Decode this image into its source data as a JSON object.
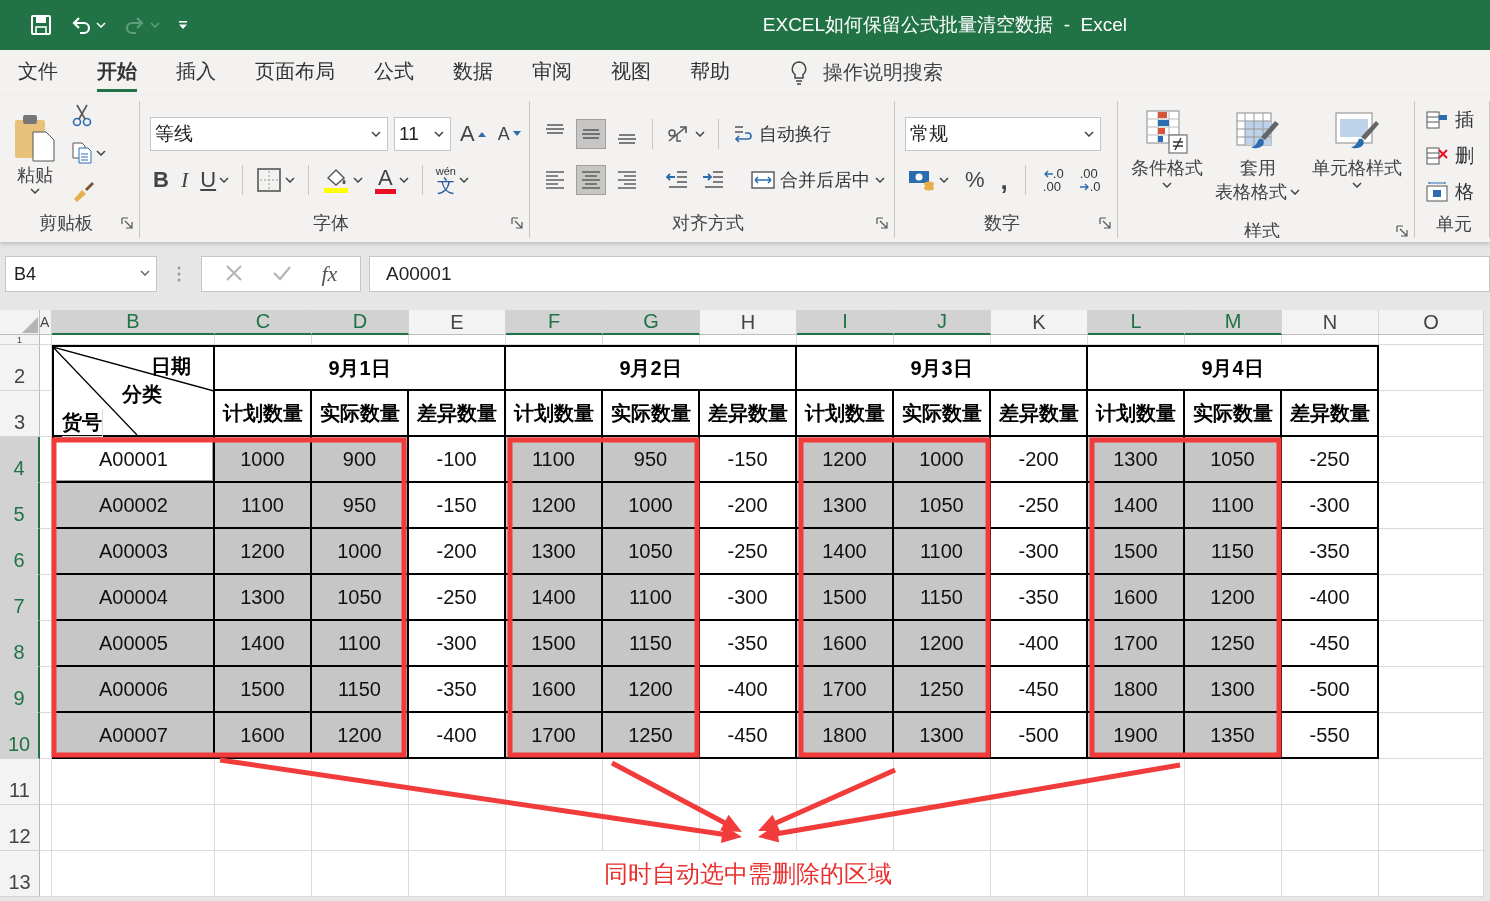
{
  "window": {
    "title": "EXCEL如何保留公式批量清空数据  -  Excel"
  },
  "quick_access": [
    {
      "kind": "save",
      "disabled": false
    },
    {
      "kind": "undo",
      "disabled": false
    },
    {
      "kind": "redo",
      "disabled": true
    },
    {
      "kind": "customize",
      "disabled": false
    }
  ],
  "menu": {
    "tabs": [
      {
        "label": "文件",
        "selected": false
      },
      {
        "label": "开始",
        "selected": true
      },
      {
        "label": "插入",
        "selected": false
      },
      {
        "label": "页面布局",
        "selected": false
      },
      {
        "label": "公式",
        "selected": false
      },
      {
        "label": "数据",
        "selected": false
      },
      {
        "label": "审阅",
        "selected": false
      },
      {
        "label": "视图",
        "selected": false
      },
      {
        "label": "帮助",
        "selected": false
      }
    ],
    "search": {
      "placeholder": "操作说明搜索"
    }
  },
  "ribbon": {
    "clipboard": {
      "paste": "粘贴",
      "label": "剪贴板"
    },
    "font": {
      "name": "等线",
      "size": "11",
      "grow": "A",
      "shrink": "A",
      "bold": "B",
      "italic": "I",
      "underline": "U",
      "color_letter": "A",
      "phonetic": "wén",
      "phonetic_char": "文",
      "label": "字体"
    },
    "alignment": {
      "vertical": [
        {
          "selected": false
        },
        {
          "selected": true
        },
        {
          "selected": false
        }
      ],
      "horizontal": [
        {
          "selected": false
        },
        {
          "selected": true
        },
        {
          "selected": false
        }
      ],
      "wrap": "自动换行",
      "merge": "合并后居中",
      "label": "对齐方式"
    },
    "number": {
      "format": "常规",
      "percent": "%",
      "comma": ",",
      "decimals": [
        {
          "top": ".0",
          "bottom": ".00"
        },
        {
          "top": ".00",
          "bottom": ".0"
        }
      ],
      "label": "数字"
    },
    "styles": {
      "buttons": [
        {
          "kind": "conditional",
          "lines": [
            "条件格式"
          ]
        },
        {
          "kind": "table",
          "lines": [
            "套用",
            "表格格式"
          ]
        },
        {
          "kind": "cell",
          "lines": [
            "单元格样式"
          ]
        }
      ],
      "label": "样式"
    },
    "cells": {
      "buttons": [
        {
          "kind": "insert",
          "label": "插"
        },
        {
          "kind": "delete",
          "label": "删"
        },
        {
          "kind": "format",
          "label": "格"
        }
      ],
      "label": "单元"
    }
  },
  "formula_bar": {
    "name_box": "B4",
    "function_button": "fx",
    "formula": "A00001"
  },
  "sheet": {
    "columns": [
      {
        "label": "A",
        "selected": false
      },
      {
        "label": "B",
        "selected": true
      },
      {
        "label": "C",
        "selected": true
      },
      {
        "label": "D",
        "selected": true
      },
      {
        "label": "E",
        "selected": false
      },
      {
        "label": "F",
        "selected": true
      },
      {
        "label": "G",
        "selected": true
      },
      {
        "label": "H",
        "selected": false
      },
      {
        "label": "I",
        "selected": true
      },
      {
        "label": "J",
        "selected": true
      },
      {
        "label": "K",
        "selected": false
      },
      {
        "label": "L",
        "selected": true
      },
      {
        "label": "M",
        "selected": true
      },
      {
        "label": "N",
        "selected": false
      },
      {
        "label": "O",
        "selected": false
      }
    ],
    "rows": [
      {
        "label": "1",
        "selected": false
      },
      {
        "label": "2",
        "selected": false
      },
      {
        "label": "3",
        "selected": false
      },
      {
        "label": "4",
        "selected": true
      },
      {
        "label": "5",
        "selected": true
      },
      {
        "label": "6",
        "selected": true
      },
      {
        "label": "7",
        "selected": true
      },
      {
        "label": "8",
        "selected": true
      },
      {
        "label": "9",
        "selected": true
      },
      {
        "label": "10",
        "selected": true
      },
      {
        "label": "11",
        "selected": false
      },
      {
        "label": "12",
        "selected": false
      },
      {
        "label": "13",
        "selected": false
      }
    ],
    "corner": {
      "top": "日期",
      "middle": "分类",
      "bottom": "货号"
    },
    "dates": [
      "9月1日",
      "9月2日",
      "9月3日",
      "9月4日"
    ],
    "subheaders": [
      "计划数量",
      "实际数量",
      "差异数量",
      "计划数量",
      "实际数量",
      "差异数量",
      "计划数量",
      "实际数量",
      "差异数量",
      "计划数量",
      "实际数量",
      "差异数量"
    ],
    "data": [
      {
        "cells": [
          {
            "text": "A00001",
            "selected": true,
            "active": true
          },
          {
            "text": "1000",
            "selected": true,
            "active": false
          },
          {
            "text": "900",
            "selected": true,
            "active": false
          },
          {
            "text": "-100",
            "selected": false,
            "active": false
          },
          {
            "text": "1100",
            "selected": true,
            "active": false
          },
          {
            "text": "950",
            "selected": true,
            "active": false
          },
          {
            "text": "-150",
            "selected": false,
            "active": false
          },
          {
            "text": "1200",
            "selected": true,
            "active": false
          },
          {
            "text": "1000",
            "selected": true,
            "active": false
          },
          {
            "text": "-200",
            "selected": false,
            "active": false
          },
          {
            "text": "1300",
            "selected": true,
            "active": false
          },
          {
            "text": "1050",
            "selected": true,
            "active": false
          },
          {
            "text": "-250",
            "selected": false,
            "active": false
          }
        ]
      },
      {
        "cells": [
          {
            "text": "A00002",
            "selected": true,
            "active": false
          },
          {
            "text": "1100",
            "selected": true,
            "active": false
          },
          {
            "text": "950",
            "selected": true,
            "active": false
          },
          {
            "text": "-150",
            "selected": false,
            "active": false
          },
          {
            "text": "1200",
            "selected": true,
            "active": false
          },
          {
            "text": "1000",
            "selected": true,
            "active": false
          },
          {
            "text": "-200",
            "selected": false,
            "active": false
          },
          {
            "text": "1300",
            "selected": true,
            "active": false
          },
          {
            "text": "1050",
            "selected": true,
            "active": false
          },
          {
            "text": "-250",
            "selected": false,
            "active": false
          },
          {
            "text": "1400",
            "selected": true,
            "active": false
          },
          {
            "text": "1100",
            "selected": true,
            "active": false
          },
          {
            "text": "-300",
            "selected": false,
            "active": false
          }
        ]
      },
      {
        "cells": [
          {
            "text": "A00003",
            "selected": true,
            "active": false
          },
          {
            "text": "1200",
            "selected": true,
            "active": false
          },
          {
            "text": "1000",
            "selected": true,
            "active": false
          },
          {
            "text": "-200",
            "selected": false,
            "active": false
          },
          {
            "text": "1300",
            "selected": true,
            "active": false
          },
          {
            "text": "1050",
            "selected": true,
            "active": false
          },
          {
            "text": "-250",
            "selected": false,
            "active": false
          },
          {
            "text": "1400",
            "selected": true,
            "active": false
          },
          {
            "text": "1100",
            "selected": true,
            "active": false
          },
          {
            "text": "-300",
            "selected": false,
            "active": false
          },
          {
            "text": "1500",
            "selected": true,
            "active": false
          },
          {
            "text": "1150",
            "selected": true,
            "active": false
          },
          {
            "text": "-350",
            "selected": false,
            "active": false
          }
        ]
      },
      {
        "cells": [
          {
            "text": "A00004",
            "selected": true,
            "active": false
          },
          {
            "text": "1300",
            "selected": true,
            "active": false
          },
          {
            "text": "1050",
            "selected": true,
            "active": false
          },
          {
            "text": "-250",
            "selected": false,
            "active": false
          },
          {
            "text": "1400",
            "selected": true,
            "active": false
          },
          {
            "text": "1100",
            "selected": true,
            "active": false
          },
          {
            "text": "-300",
            "selected": false,
            "active": false
          },
          {
            "text": "1500",
            "selected": true,
            "active": false
          },
          {
            "text": "1150",
            "selected": true,
            "active": false
          },
          {
            "text": "-350",
            "selected": false,
            "active": false
          },
          {
            "text": "1600",
            "selected": true,
            "active": false
          },
          {
            "text": "1200",
            "selected": true,
            "active": false
          },
          {
            "text": "-400",
            "selected": false,
            "active": false
          }
        ]
      },
      {
        "cells": [
          {
            "text": "A00005",
            "selected": true,
            "active": false
          },
          {
            "text": "1400",
            "selected": true,
            "active": false
          },
          {
            "text": "1100",
            "selected": true,
            "active": false
          },
          {
            "text": "-300",
            "selected": false,
            "active": false
          },
          {
            "text": "1500",
            "selected": true,
            "active": false
          },
          {
            "text": "1150",
            "selected": true,
            "active": false
          },
          {
            "text": "-350",
            "selected": false,
            "active": false
          },
          {
            "text": "1600",
            "selected": true,
            "active": false
          },
          {
            "text": "1200",
            "selected": true,
            "active": false
          },
          {
            "text": "-400",
            "selected": false,
            "active": false
          },
          {
            "text": "1700",
            "selected": true,
            "active": false
          },
          {
            "text": "1250",
            "selected": true,
            "active": false
          },
          {
            "text": "-450",
            "selected": false,
            "active": false
          }
        ]
      },
      {
        "cells": [
          {
            "text": "A00006",
            "selected": true,
            "active": false
          },
          {
            "text": "1500",
            "selected": true,
            "active": false
          },
          {
            "text": "1150",
            "selected": true,
            "active": false
          },
          {
            "text": "-350",
            "selected": false,
            "active": false
          },
          {
            "text": "1600",
            "selected": true,
            "active": false
          },
          {
            "text": "1200",
            "selected": true,
            "active": false
          },
          {
            "text": "-400",
            "selected": false,
            "active": false
          },
          {
            "text": "1700",
            "selected": true,
            "active": false
          },
          {
            "text": "1250",
            "selected": true,
            "active": false
          },
          {
            "text": "-450",
            "selected": false,
            "active": false
          },
          {
            "text": "1800",
            "selected": true,
            "active": false
          },
          {
            "text": "1300",
            "selected": true,
            "active": false
          },
          {
            "text": "-500",
            "selected": false,
            "active": false
          }
        ]
      },
      {
        "cells": [
          {
            "text": "A00007",
            "selected": true,
            "active": false
          },
          {
            "text": "1600",
            "selected": true,
            "active": false
          },
          {
            "text": "1200",
            "selected": true,
            "active": false
          },
          {
            "text": "-400",
            "selected": false,
            "active": false
          },
          {
            "text": "1700",
            "selected": true,
            "active": false
          },
          {
            "text": "1250",
            "selected": true,
            "active": false
          },
          {
            "text": "-450",
            "selected": false,
            "active": false
          },
          {
            "text": "1800",
            "selected": true,
            "active": false
          },
          {
            "text": "1300",
            "selected": true,
            "active": false
          },
          {
            "text": "-500",
            "selected": false,
            "active": false
          },
          {
            "text": "1900",
            "selected": true,
            "active": false
          },
          {
            "text": "1350",
            "selected": true,
            "active": false
          },
          {
            "text": "-550",
            "selected": false,
            "active": false
          }
        ]
      }
    ]
  },
  "annotation": {
    "caption": "同时自动选中需删除的区域"
  }
}
